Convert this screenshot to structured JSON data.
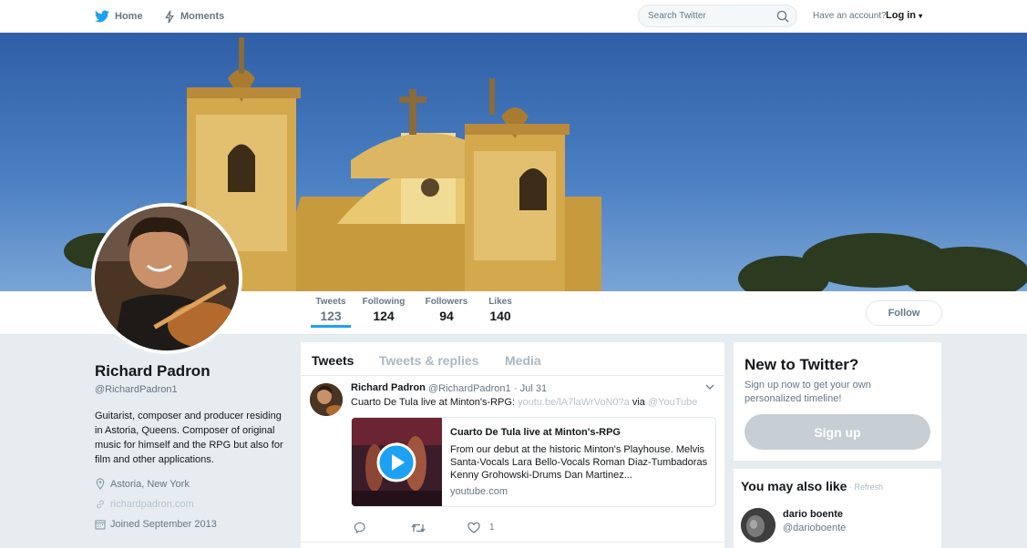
{
  "topbar": {
    "home_label": "Home",
    "moments_label": "Moments",
    "search_placeholder": "Search Twitter",
    "account_prompt": "Have an account?",
    "login_label": "Log in"
  },
  "colors": {
    "accent": "#1da1f2",
    "text_primary": "#14171a",
    "text_secondary": "#657786",
    "background": "#e6ecf0"
  },
  "stats": [
    {
      "label": "Tweets",
      "value": "123",
      "active": true
    },
    {
      "label": "Following",
      "value": "124"
    },
    {
      "label": "Followers",
      "value": "94"
    },
    {
      "label": "Likes",
      "value": "140"
    }
  ],
  "follow_label": "Follow",
  "profile": {
    "name": "Richard Padron",
    "handle": "@RichardPadron1",
    "bio": "Guitarist, composer and producer residing in Astoria, Queens. Composer of original music for himself and the RPG but also for film and other applications.",
    "location": "Astoria, New York",
    "website": "richardpadron.com",
    "joined": "Joined September 2013"
  },
  "tabs": [
    {
      "label": "Tweets",
      "active": true
    },
    {
      "label": "Tweets & replies"
    },
    {
      "label": "Media"
    }
  ],
  "tweet": {
    "name": "Richard Padron",
    "handle": "@RichardPadron1",
    "date": "· Jul 31",
    "text": "Cuarto De Tula live at Minton's-RPG:",
    "link": "youtu.be/lA7laWrVoN0?a",
    "via": "via",
    "via_handle": "@YouTube",
    "card": {
      "title": "Cuarto De Tula live at Minton's-RPG",
      "description": "From our debut at the historic Minton's Playhouse. Melvis Santa-Vocals Lara Bello-Vocals Roman Diaz-Tumbadoras Kenny Grohowski-Drums Dan Martinez...",
      "domain": "youtube.com"
    },
    "likes": "1"
  },
  "signup": {
    "title": "New to Twitter?",
    "subtitle": "Sign up now to get your own personalized timeline!",
    "button": "Sign up"
  },
  "suggestions": {
    "title": "You may also like",
    "refresh": "· Refresh",
    "users": [
      {
        "name": "dario boente",
        "handle": "@darioboente"
      }
    ]
  }
}
